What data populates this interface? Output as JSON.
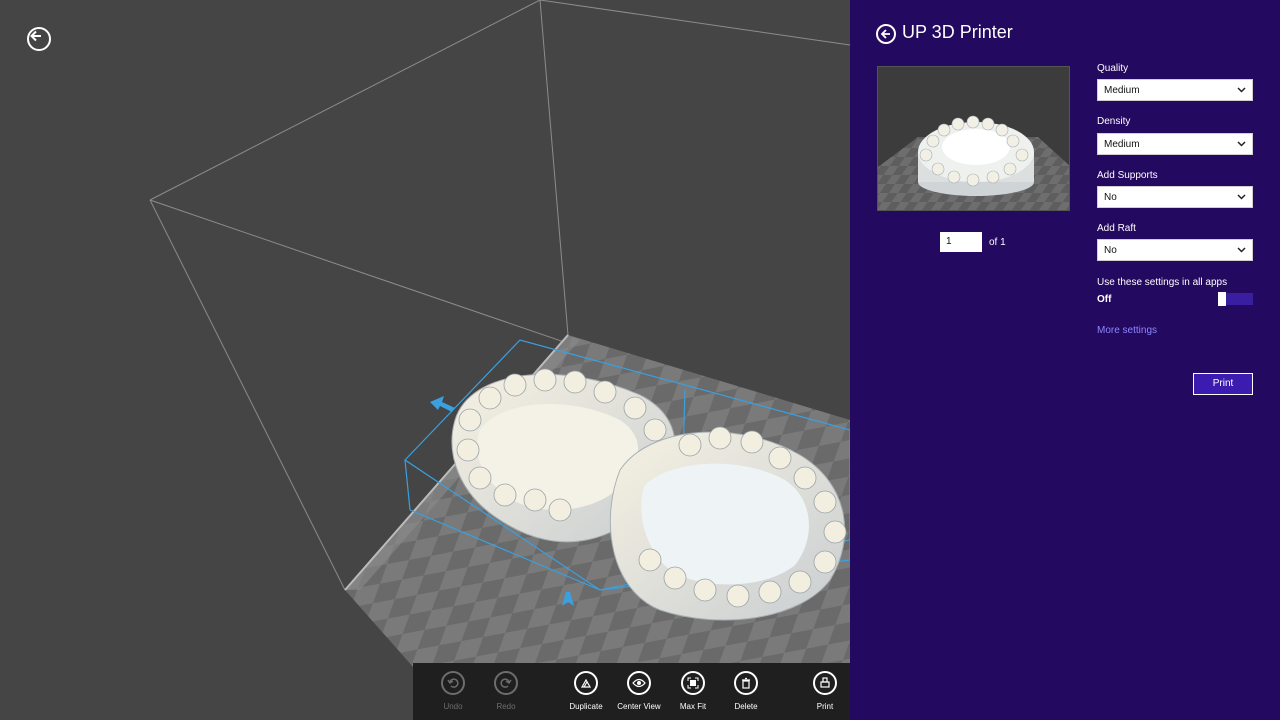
{
  "panel": {
    "title": "UP 3D Printer",
    "page_number": "1",
    "page_of": "of 1",
    "quality_label": "Quality",
    "quality_value": "Medium",
    "density_label": "Density",
    "density_value": "Medium",
    "supports_label": "Add Supports",
    "supports_value": "No",
    "raft_label": "Add Raft",
    "raft_value": "No",
    "toggle_label": "Use these settings in all apps",
    "toggle_state": "Off",
    "more_settings": "More settings",
    "print_button": "Print"
  },
  "appbar": {
    "undo": "Undo",
    "redo": "Redo",
    "duplicate": "Duplicate",
    "center_view": "Center View",
    "max_fit": "Max Fit",
    "delete": "Delete",
    "print": "Print"
  },
  "colors": {
    "panel_bg": "#23095f",
    "accent": "#3b1bb0",
    "link": "#8f87ff",
    "selection_box": "#3aa0e0"
  },
  "icons": [
    "back-arrow-icon",
    "undo-icon",
    "redo-icon",
    "duplicate-icon",
    "eye-icon",
    "max-fit-icon",
    "trash-icon",
    "printer-icon",
    "chevron-down-icon"
  ]
}
